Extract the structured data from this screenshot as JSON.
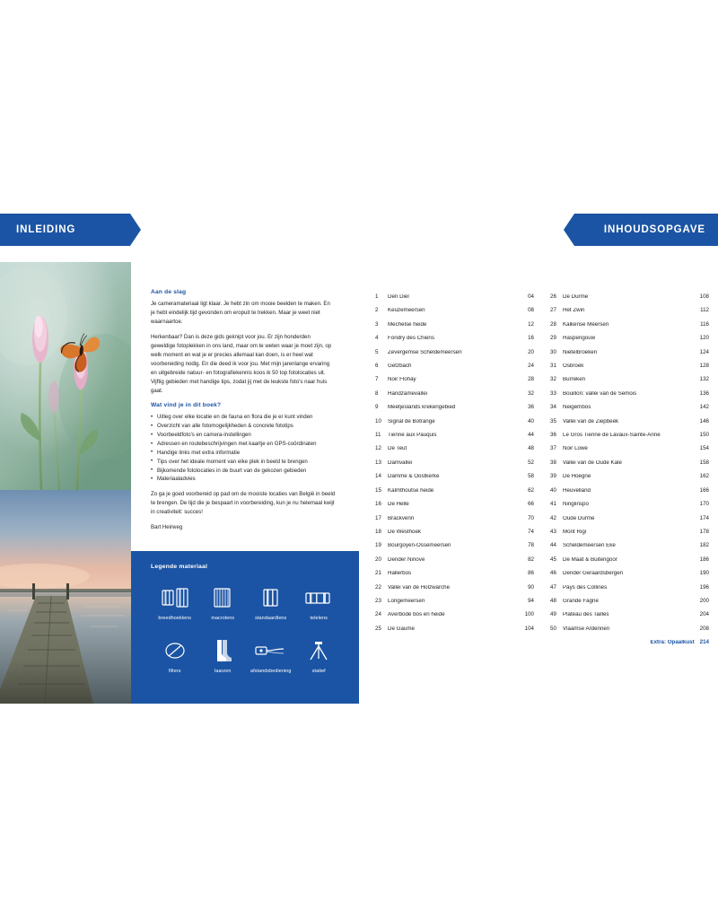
{
  "left": {
    "banner_label": "INLEIDING",
    "section1_heading": "Aan de slag",
    "paragraph1": "Je cameramateriaal ligt klaar. Je hebt zin om mooie beelden te maken. En je hebt eindelijk tijd gevonden om eropuit te trekken. Maar je weet niet waarnaartoe.",
    "paragraph2": "Herkenbaar? Dan is deze gids geknipt voor jou. Er zijn honderden geweldige fotoplekken in ons land, maar om te weten waar je moet zijn, op welk moment en wat je er precies allemaal kan doen, is er heel wat voorbereiding nodig. En die deed ik voor jou. Met mijn jarenlange ervaring en uitgebreide natuur- en fotografiekennis koos ik 50 top fotolocaties uit. Vijftig gebieden met handige tips, zodat jij met de leukste foto's naar huis gaat.",
    "section2_heading": "Wat vind je in dit boek?",
    "bullets": [
      "Uitleg over elke locatie en de fauna en flora die je er kunt vinden",
      "Overzicht van alle fotomogelijkheden & concrete fototips",
      "Voorbeeldfoto's en camera-instellingen",
      "Adressen en routebeschrijvingen met kaartje en GPS-coördinaten",
      "Handige links met extra informatie",
      "Tips over het ideale moment van elke plek in beeld te brengen",
      "Bijkomende fotolocaties in de buurt van de gekozen gebieden",
      "Materiaaladvies"
    ],
    "paragraph3": "Zo ga je goed voorbereid op pad om de mooiste locaties van België in beeld te brengen. De tijd die je bespaart in voorbereiding, kun je nu helemaal kwijt in creativiteit: succes!",
    "signature": "Bart Heirweg",
    "legend_title": "Legende materiaal",
    "legend_items": [
      {
        "icon": "wide-angle-lens-icon",
        "label": "breedhoeklens"
      },
      {
        "icon": "macro-lens-icon",
        "label": "macrolens"
      },
      {
        "icon": "standard-lens-icon",
        "label": "standaardlens"
      },
      {
        "icon": "telephoto-lens-icon",
        "label": "telelens"
      },
      {
        "icon": "filter-icon",
        "label": "filters"
      },
      {
        "icon": "boots-icon",
        "label": "laarzen"
      },
      {
        "icon": "remote-release-icon",
        "label": "afstandsbediening"
      },
      {
        "icon": "tripod-icon",
        "label": "statief"
      }
    ]
  },
  "right": {
    "banner_label": "INHOUDSOPGAVE",
    "column1": [
      {
        "num": "1",
        "title": "Den Diel",
        "page": "04"
      },
      {
        "num": "2",
        "title": "Keuzemeersen",
        "page": "08"
      },
      {
        "num": "3",
        "title": "Mechelse heide",
        "page": "12"
      },
      {
        "num": "4",
        "title": "Fondry des Chiens",
        "page": "16"
      },
      {
        "num": "5",
        "title": "Zevergemse Scheldemeersen",
        "page": "20"
      },
      {
        "num": "6",
        "title": "Getzbach",
        "page": "24"
      },
      {
        "num": "7",
        "title": "Noir Flohay",
        "page": "28"
      },
      {
        "num": "8",
        "title": "Handzamevallei",
        "page": "32"
      },
      {
        "num": "9",
        "title": "Meetjeslands krekengebied",
        "page": "36"
      },
      {
        "num": "10",
        "title": "Signal de Botrange",
        "page": "40"
      },
      {
        "num": "11",
        "title": "Tienne aux Pauquis",
        "page": "44"
      },
      {
        "num": "12",
        "title": "De Teut",
        "page": "48"
      },
      {
        "num": "13",
        "title": "Damvallei",
        "page": "52"
      },
      {
        "num": "14",
        "title": "Damme & Oostkerke",
        "page": "58"
      },
      {
        "num": "15",
        "title": "Kalmthoutse heide",
        "page": "62"
      },
      {
        "num": "16",
        "title": "De Helle",
        "page": "66"
      },
      {
        "num": "17",
        "title": "Brackvenn",
        "page": "70"
      },
      {
        "num": "18",
        "title": "De Westhoek",
        "page": "74"
      },
      {
        "num": "19",
        "title": "Bourgoyen-Ossemeersen",
        "page": "78"
      },
      {
        "num": "20",
        "title": "Dender Ninove",
        "page": "82"
      },
      {
        "num": "21",
        "title": "Hallerbos",
        "page": "86"
      },
      {
        "num": "22",
        "title": "Vallei van de Holzwarche",
        "page": "90"
      },
      {
        "num": "23",
        "title": "Longemeersen",
        "page": "94"
      },
      {
        "num": "24",
        "title": "Averbode bos en heide",
        "page": "100"
      },
      {
        "num": "25",
        "title": "De Gaume",
        "page": "104"
      }
    ],
    "column2": [
      {
        "num": "26",
        "title": "De Durme",
        "page": "108"
      },
      {
        "num": "27",
        "title": "Het Zwin",
        "page": "112"
      },
      {
        "num": "28",
        "title": "Kalkense Meersen",
        "page": "116"
      },
      {
        "num": "29",
        "title": "Haspengouw",
        "page": "120"
      },
      {
        "num": "30",
        "title": "Nietelbroeken",
        "page": "124"
      },
      {
        "num": "31",
        "title": "Osbroek",
        "page": "128"
      },
      {
        "num": "32",
        "title": "Burreken",
        "page": "132"
      },
      {
        "num": "33",
        "title": "Bouillon: vallei van de Semois",
        "page": "136"
      },
      {
        "num": "34",
        "title": "Neigembos",
        "page": "142"
      },
      {
        "num": "35",
        "title": "Vallei van de Ziepbeek",
        "page": "146"
      },
      {
        "num": "36",
        "title": "Le Gros Tienne de Lavaux-Sainte-Anne",
        "page": "150"
      },
      {
        "num": "37",
        "title": "Noir Lowé",
        "page": "154"
      },
      {
        "num": "38",
        "title": "Vallei van de Oude Kale",
        "page": "158"
      },
      {
        "num": "39",
        "title": "De Hoëgne",
        "page": "162"
      },
      {
        "num": "40",
        "title": "Heuvelland",
        "page": "166"
      },
      {
        "num": "41",
        "title": "Ninglinspo",
        "page": "170"
      },
      {
        "num": "42",
        "title": "Oude Durme",
        "page": "174"
      },
      {
        "num": "43",
        "title": "Mont Rigi",
        "page": "178"
      },
      {
        "num": "44",
        "title": "Scheldemeersen Eke",
        "page": "182"
      },
      {
        "num": "45",
        "title": "De Maat & Buitengoor",
        "page": "186"
      },
      {
        "num": "46",
        "title": "Dender Geraardsbergen",
        "page": "190"
      },
      {
        "num": "47",
        "title": "Pays des Collines",
        "page": "196"
      },
      {
        "num": "48",
        "title": "Grande Fagne",
        "page": "200"
      },
      {
        "num": "49",
        "title": "Plateau des Tailles",
        "page": "204"
      },
      {
        "num": "50",
        "title": "Vlaamse Ardennen",
        "page": "208"
      }
    ],
    "extra": {
      "title": "Extra: Opaalkust",
      "page": "214"
    }
  },
  "colors": {
    "brand_blue": "#1B54A4",
    "text": "#222222"
  }
}
